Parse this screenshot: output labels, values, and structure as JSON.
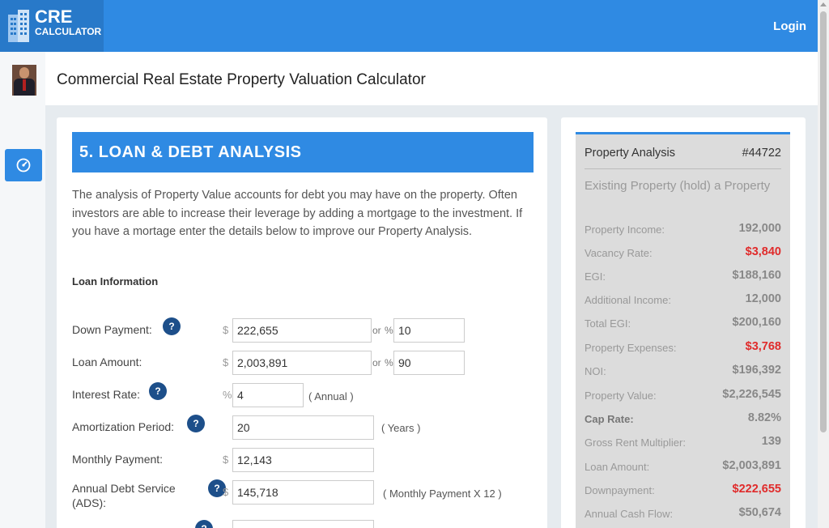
{
  "brand": {
    "line1": "CRE",
    "line2": "CALCULATOR"
  },
  "nav": {
    "login_label": "Login"
  },
  "page": {
    "title": "Commercial Real Estate Property Valuation Calculator"
  },
  "section": {
    "title": "5. LOAN & DEBT ANALYSIS",
    "intro": "The analysis of Property Value accounts for debt you may have on the property. Often investors are able to increase their leverage by adding a mortgage to the investment. If you have a mortage enter the details below to improve our Property Analysis.",
    "subheading": "Loan Information"
  },
  "form": {
    "help_glyph": "?",
    "down_payment": {
      "label": "Down Payment:",
      "currency": "$",
      "value": "222,655",
      "or": "or",
      "pct": "%",
      "pct_value": "10"
    },
    "loan_amount": {
      "label": "Loan Amount:",
      "currency": "$",
      "value": "2,003,891",
      "or": "or",
      "pct": "%",
      "pct_value": "90"
    },
    "interest_rate": {
      "label": "Interest Rate:",
      "unit": "%",
      "value": "4",
      "note": "( Annual )"
    },
    "amortization": {
      "label": "Amortization Period:",
      "value": "20",
      "note": "( Years )"
    },
    "monthly_payment": {
      "label": "Monthly Payment:",
      "currency": "$",
      "value": "12,143"
    },
    "ads": {
      "label_line1": "Annual Debt Service",
      "label_line2": "(ADS):",
      "currency": "$",
      "value": "145,718",
      "note": "( Monthly Payment X 12 )"
    }
  },
  "summary": {
    "title": "Property Analysis",
    "id": "#44722",
    "type": "Existing Property (hold) a Property",
    "rows": [
      {
        "label": "Property Income:",
        "value": "192,000"
      },
      {
        "label": "Vacancy Rate:",
        "value": "$3,840"
      },
      {
        "label": "EGI:",
        "value": "$188,160"
      },
      {
        "label": "Additional Income:",
        "value": "12,000"
      },
      {
        "label": "Total EGI:",
        "value": "$200,160"
      },
      {
        "label": "Property Expenses:",
        "value": "$3,768"
      },
      {
        "label": "NOI:",
        "value": "$196,392"
      },
      {
        "label": "Property Value:",
        "value": "$2,226,545"
      },
      {
        "label": "Cap Rate:",
        "value": "8.82%"
      },
      {
        "label": "Gross Rent Multiplier:",
        "value": "139"
      },
      {
        "label": "Loan Amount:",
        "value": "$2,003,891"
      },
      {
        "label": "Downpayment:",
        "value": "$222,655"
      },
      {
        "label": "Annual Cash Flow:",
        "value": "$50,674"
      }
    ]
  },
  "colors": {
    "accent": "#2f8ae3",
    "negative": "#e02b2b",
    "help": "#1d4f8a"
  }
}
